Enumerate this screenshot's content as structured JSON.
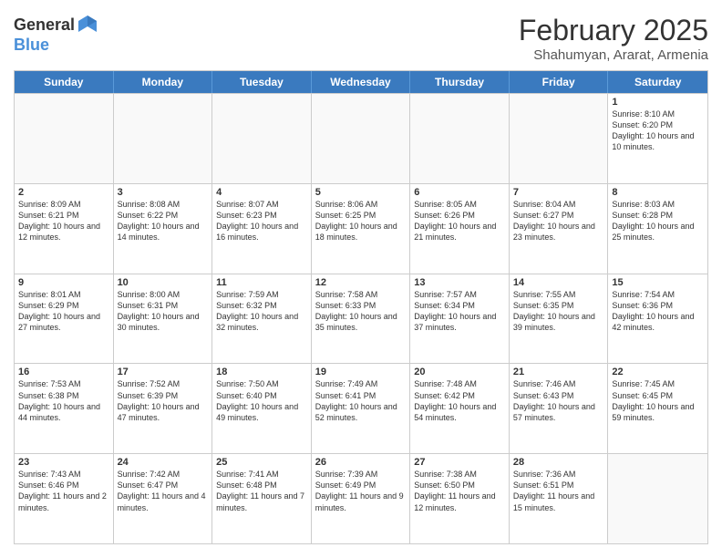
{
  "header": {
    "logo_general": "General",
    "logo_blue": "Blue",
    "month_year": "February 2025",
    "location": "Shahumyan, Ararat, Armenia"
  },
  "days_of_week": [
    "Sunday",
    "Monday",
    "Tuesday",
    "Wednesday",
    "Thursday",
    "Friday",
    "Saturday"
  ],
  "weeks": [
    [
      {
        "day": "",
        "text": ""
      },
      {
        "day": "",
        "text": ""
      },
      {
        "day": "",
        "text": ""
      },
      {
        "day": "",
        "text": ""
      },
      {
        "day": "",
        "text": ""
      },
      {
        "day": "",
        "text": ""
      },
      {
        "day": "1",
        "text": "Sunrise: 8:10 AM\nSunset: 6:20 PM\nDaylight: 10 hours and 10 minutes."
      }
    ],
    [
      {
        "day": "2",
        "text": "Sunrise: 8:09 AM\nSunset: 6:21 PM\nDaylight: 10 hours and 12 minutes."
      },
      {
        "day": "3",
        "text": "Sunrise: 8:08 AM\nSunset: 6:22 PM\nDaylight: 10 hours and 14 minutes."
      },
      {
        "day": "4",
        "text": "Sunrise: 8:07 AM\nSunset: 6:23 PM\nDaylight: 10 hours and 16 minutes."
      },
      {
        "day": "5",
        "text": "Sunrise: 8:06 AM\nSunset: 6:25 PM\nDaylight: 10 hours and 18 minutes."
      },
      {
        "day": "6",
        "text": "Sunrise: 8:05 AM\nSunset: 6:26 PM\nDaylight: 10 hours and 21 minutes."
      },
      {
        "day": "7",
        "text": "Sunrise: 8:04 AM\nSunset: 6:27 PM\nDaylight: 10 hours and 23 minutes."
      },
      {
        "day": "8",
        "text": "Sunrise: 8:03 AM\nSunset: 6:28 PM\nDaylight: 10 hours and 25 minutes."
      }
    ],
    [
      {
        "day": "9",
        "text": "Sunrise: 8:01 AM\nSunset: 6:29 PM\nDaylight: 10 hours and 27 minutes."
      },
      {
        "day": "10",
        "text": "Sunrise: 8:00 AM\nSunset: 6:31 PM\nDaylight: 10 hours and 30 minutes."
      },
      {
        "day": "11",
        "text": "Sunrise: 7:59 AM\nSunset: 6:32 PM\nDaylight: 10 hours and 32 minutes."
      },
      {
        "day": "12",
        "text": "Sunrise: 7:58 AM\nSunset: 6:33 PM\nDaylight: 10 hours and 35 minutes."
      },
      {
        "day": "13",
        "text": "Sunrise: 7:57 AM\nSunset: 6:34 PM\nDaylight: 10 hours and 37 minutes."
      },
      {
        "day": "14",
        "text": "Sunrise: 7:55 AM\nSunset: 6:35 PM\nDaylight: 10 hours and 39 minutes."
      },
      {
        "day": "15",
        "text": "Sunrise: 7:54 AM\nSunset: 6:36 PM\nDaylight: 10 hours and 42 minutes."
      }
    ],
    [
      {
        "day": "16",
        "text": "Sunrise: 7:53 AM\nSunset: 6:38 PM\nDaylight: 10 hours and 44 minutes."
      },
      {
        "day": "17",
        "text": "Sunrise: 7:52 AM\nSunset: 6:39 PM\nDaylight: 10 hours and 47 minutes."
      },
      {
        "day": "18",
        "text": "Sunrise: 7:50 AM\nSunset: 6:40 PM\nDaylight: 10 hours and 49 minutes."
      },
      {
        "day": "19",
        "text": "Sunrise: 7:49 AM\nSunset: 6:41 PM\nDaylight: 10 hours and 52 minutes."
      },
      {
        "day": "20",
        "text": "Sunrise: 7:48 AM\nSunset: 6:42 PM\nDaylight: 10 hours and 54 minutes."
      },
      {
        "day": "21",
        "text": "Sunrise: 7:46 AM\nSunset: 6:43 PM\nDaylight: 10 hours and 57 minutes."
      },
      {
        "day": "22",
        "text": "Sunrise: 7:45 AM\nSunset: 6:45 PM\nDaylight: 10 hours and 59 minutes."
      }
    ],
    [
      {
        "day": "23",
        "text": "Sunrise: 7:43 AM\nSunset: 6:46 PM\nDaylight: 11 hours and 2 minutes."
      },
      {
        "day": "24",
        "text": "Sunrise: 7:42 AM\nSunset: 6:47 PM\nDaylight: 11 hours and 4 minutes."
      },
      {
        "day": "25",
        "text": "Sunrise: 7:41 AM\nSunset: 6:48 PM\nDaylight: 11 hours and 7 minutes."
      },
      {
        "day": "26",
        "text": "Sunrise: 7:39 AM\nSunset: 6:49 PM\nDaylight: 11 hours and 9 minutes."
      },
      {
        "day": "27",
        "text": "Sunrise: 7:38 AM\nSunset: 6:50 PM\nDaylight: 11 hours and 12 minutes."
      },
      {
        "day": "28",
        "text": "Sunrise: 7:36 AM\nSunset: 6:51 PM\nDaylight: 11 hours and 15 minutes."
      },
      {
        "day": "",
        "text": ""
      }
    ]
  ]
}
